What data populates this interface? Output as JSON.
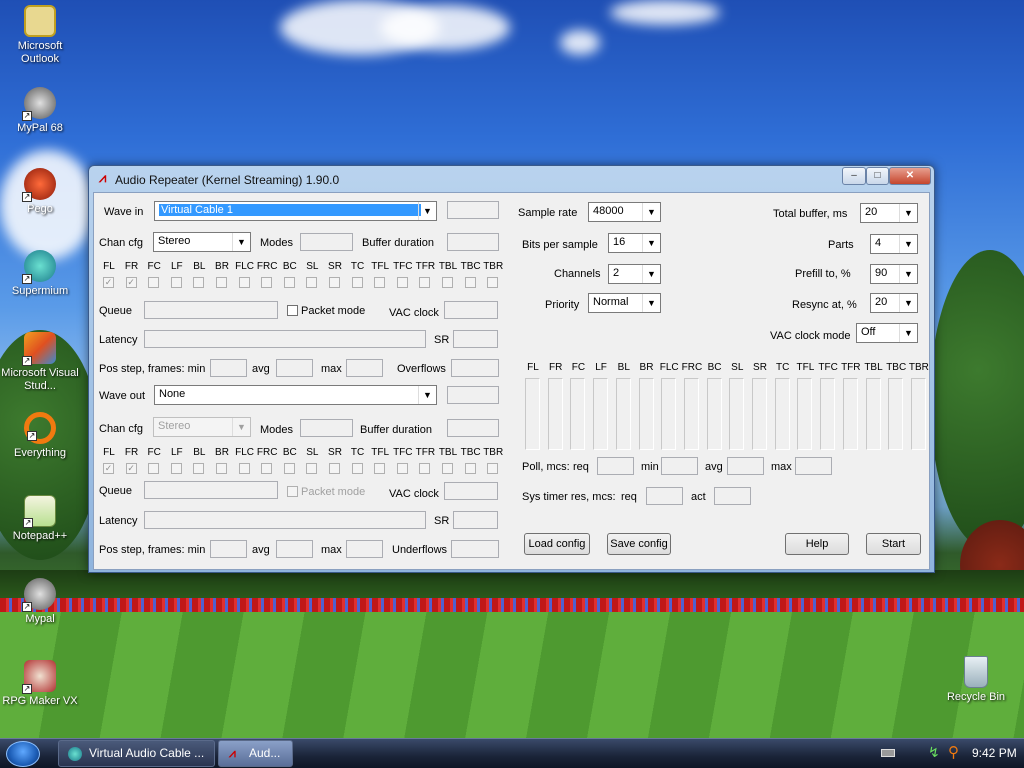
{
  "desktop": {
    "icons": [
      {
        "label": "Microsoft Outlook"
      },
      {
        "label": "MyPal 68"
      },
      {
        "label": "Pego"
      },
      {
        "label": "Supermium"
      },
      {
        "label": "Microsoft Visual Stud..."
      },
      {
        "label": "Everything"
      },
      {
        "label": "Notepad++"
      },
      {
        "label": "Mypal"
      },
      {
        "label": "RPG Maker VX"
      },
      {
        "label": "Recycle Bin"
      }
    ]
  },
  "window": {
    "title": "Audio Repeater (Kernel Streaming) 1.90.0",
    "minimize": "–",
    "maximize": "□",
    "close": "✕",
    "wave_in": {
      "label": "Wave in",
      "device": "Virtual Cable 1",
      "chan_cfg_label": "Chan cfg",
      "chan_cfg": "Stereo",
      "modes_label": "Modes",
      "buffer_duration_label": "Buffer duration",
      "queue_label": "Queue",
      "packet_mode_label": "Packet mode",
      "vac_clock_label": "VAC clock",
      "latency_label": "Latency",
      "sr_label": "SR",
      "pos_step_label": "Pos step, frames: min",
      "avg_label": "avg",
      "max_label": "max",
      "overflows_label": "Overflows"
    },
    "wave_out": {
      "label": "Wave out",
      "device": "None",
      "chan_cfg_label": "Chan cfg",
      "chan_cfg": "Stereo",
      "modes_label": "Modes",
      "buffer_duration_label": "Buffer duration",
      "queue_label": "Queue",
      "packet_mode_label": "Packet mode",
      "vac_clock_label": "VAC clock",
      "latency_label": "Latency",
      "sr_label": "SR",
      "pos_step_label": "Pos step, frames: min",
      "avg_label": "avg",
      "max_label": "max",
      "underflows_label": "Underflows"
    },
    "channels": [
      "FL",
      "FR",
      "FC",
      "LF",
      "BL",
      "BR",
      "FLC",
      "FRC",
      "BC",
      "SL",
      "SR",
      "TC",
      "TFL",
      "TFC",
      "TFR",
      "TBL",
      "TBC",
      "TBR"
    ],
    "meter_channels": [
      "FL",
      "FR",
      "FC",
      "LF",
      "BL",
      "BR",
      "FLC",
      "FRC",
      "BC",
      "SL",
      "SR",
      "TC",
      "TFL",
      "TFC",
      "TFR",
      "TBL",
      "TBC",
      "TBR"
    ],
    "format": {
      "sample_rate_label": "Sample rate",
      "sample_rate": "48000",
      "bits_label": "Bits per sample",
      "bits": "16",
      "channels_label": "Channels",
      "channels": "2",
      "priority_label": "Priority",
      "priority": "Normal"
    },
    "buffer": {
      "total_label": "Total buffer, ms",
      "total": "20",
      "parts_label": "Parts",
      "parts": "4",
      "prefill_label": "Prefill to, %",
      "prefill": "90",
      "resync_label": "Resync at, %",
      "resync": "20",
      "vac_clock_mode_label": "VAC clock mode",
      "vac_clock_mode": "Off"
    },
    "poll": {
      "label": "Poll, mcs:",
      "req_label": "req",
      "min_label": "min",
      "avg_label": "avg",
      "max_label": "max"
    },
    "systimer": {
      "label": "Sys timer res, mcs:",
      "req_label": "req",
      "act_label": "act"
    },
    "buttons": {
      "load": "Load config",
      "save": "Save config",
      "help": "Help",
      "start": "Start"
    }
  },
  "taskbar": {
    "items": [
      {
        "label": "Virtual Audio Cable ..."
      },
      {
        "label": "Aud..."
      }
    ],
    "clock": "9:42 PM"
  }
}
